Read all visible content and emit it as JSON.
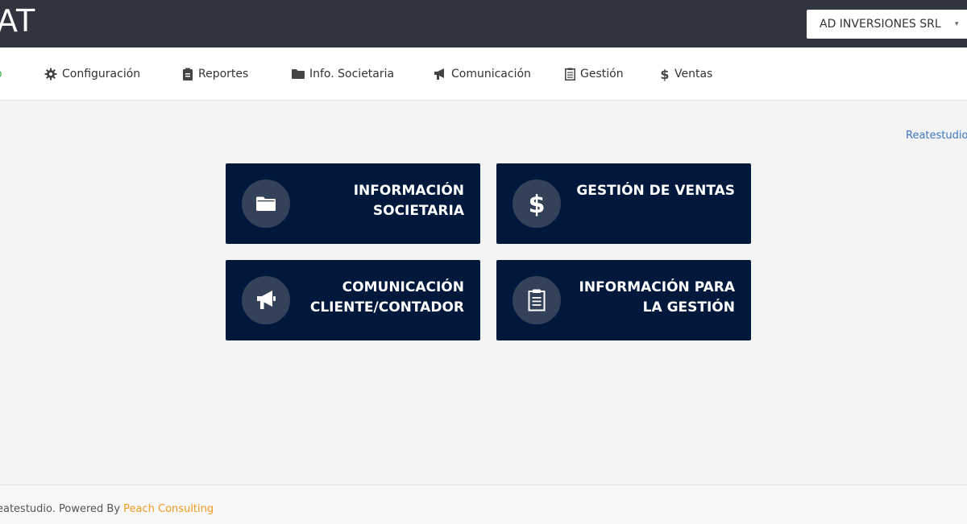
{
  "header": {
    "logo_text": "AT",
    "company_select": {
      "value": "AD INVERSIONES SRL",
      "caret": "▾"
    }
  },
  "nav": {
    "partial_item": "o",
    "items": [
      {
        "label": "Configuración",
        "icon": "gear-icon"
      },
      {
        "label": "Reportes",
        "icon": "clipboard-icon"
      },
      {
        "label": "Info. Societaria",
        "icon": "folder-icon"
      },
      {
        "label": "Comunicación",
        "icon": "megaphone-icon"
      },
      {
        "label": "Gestión",
        "icon": "document-list-icon"
      },
      {
        "label": "Ventas",
        "icon": "dollar-icon"
      }
    ]
  },
  "user_link": "Reatestudio",
  "cards": [
    {
      "title": "INFORMACIÓN\nSOCIETARIA",
      "icon": "folder-icon"
    },
    {
      "title": "GESTIÓN DE VENTAS",
      "icon": "dollar-icon"
    },
    {
      "title": "COMUNICACIÓN\nCLIENTE/CONTADOR",
      "icon": "megaphone-icon"
    },
    {
      "title": "INFORMACIÓN PARA\nLA GESTIÓN",
      "icon": "clipboard-list-icon"
    }
  ],
  "footer": {
    "text": "eatestudio. Powered By ",
    "brand": "Peach Consulting"
  },
  "colors": {
    "header_bg": "#30343f",
    "card_bg": "#00183b",
    "card_circle": "#344259",
    "link": "#3a78c3",
    "brand": "#f29a1f",
    "active_nav": "#3cb54a"
  }
}
